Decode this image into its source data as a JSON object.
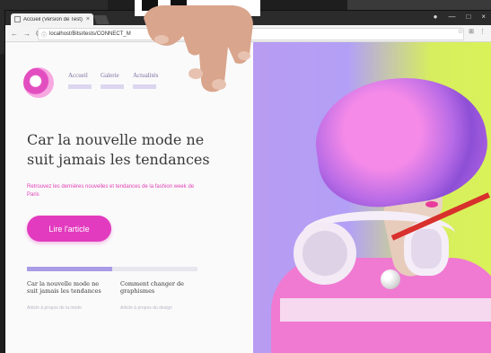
{
  "browser": {
    "tab_title": "Accueil (Version de Test)",
    "tab_close": "×",
    "url": "localhost/Bitsi/tests/CONNECT_M",
    "address_icon": "ⓘ",
    "nav_back": "←",
    "nav_forward": "→",
    "nav_reload": "C",
    "toolbar_star": "☆",
    "toolbar_ext": "⊞",
    "toolbar_menu": "⋮",
    "window_controls": [
      "●",
      "—",
      "□",
      "×"
    ]
  },
  "site": {
    "nav": [
      {
        "label": "Accueil"
      },
      {
        "label": "Galerie"
      },
      {
        "label": "Actualités"
      }
    ],
    "headline": "Car la nouvelle mode ne suit jamais les tendances",
    "intro": "Retrouvez les dernières nouvelles et tendances de la fashion week de Paris",
    "cta_label": "Lire l'article",
    "progress_fraction": 0.5,
    "cards": [
      {
        "title": "Car la nouvelle mode ne suit jamais les tendances",
        "subtitle": "Article à propos de la mode"
      },
      {
        "title": "Comment changer de graphismes",
        "subtitle": "Article à propos du design"
      }
    ]
  },
  "colors": {
    "accent": "#e23bbf",
    "nav_bar": "#dcd6f0",
    "progress": "#a99be6"
  },
  "icons": {
    "logo": "site-logo-icon",
    "hand": "hand-icon",
    "pointer": "pointer-stick-icon"
  }
}
